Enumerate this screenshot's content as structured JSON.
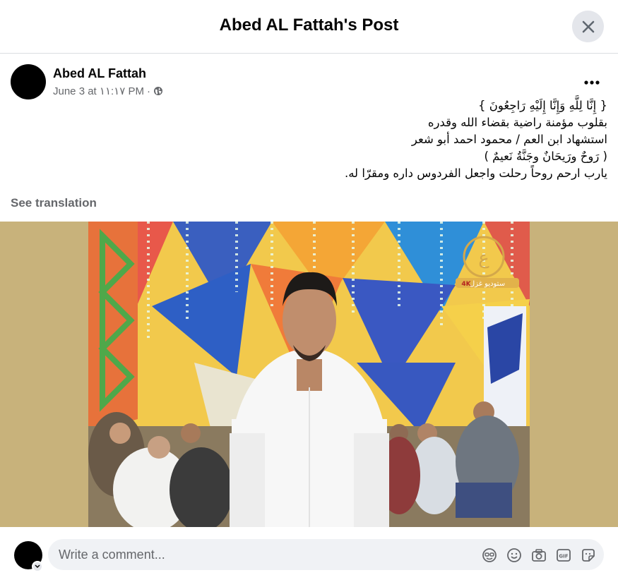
{
  "dialog": {
    "title": "Abed AL Fattah's Post",
    "close_icon": "close-icon"
  },
  "post": {
    "author": "Abed AL Fattah",
    "timestamp": "June 3 at ١١:١٧ PM",
    "separator": "·",
    "privacy_icon": "globe-icon",
    "more_icon": "more-horizontal-icon",
    "text_lines": [
      "{ إِنَّا لِلَّهِ وَإِنَّا إِلَيْهِ رَاجِعُونَ }",
      "بقلوب مؤمنة راضية بقضاء الله وقدره",
      "استشهاد ابن العم / محمود احمد أبو شعر",
      "( رَوحٌ ورَيحَانٌ وجَنَّةُ نَعيمٌ )",
      "يارب  ارحم روحاً رحلت واجعل الفردوس داره ومقرّا له."
    ],
    "see_translation": "See translation",
    "photo": {
      "watermark_text": "ستوديو غزل",
      "watermark_badge": "4K"
    }
  },
  "composer": {
    "placeholder": "Write a comment...",
    "icons": [
      "avatar-sticker-icon",
      "emoji-icon",
      "camera-icon",
      "gif-icon",
      "sticker-icon"
    ]
  }
}
